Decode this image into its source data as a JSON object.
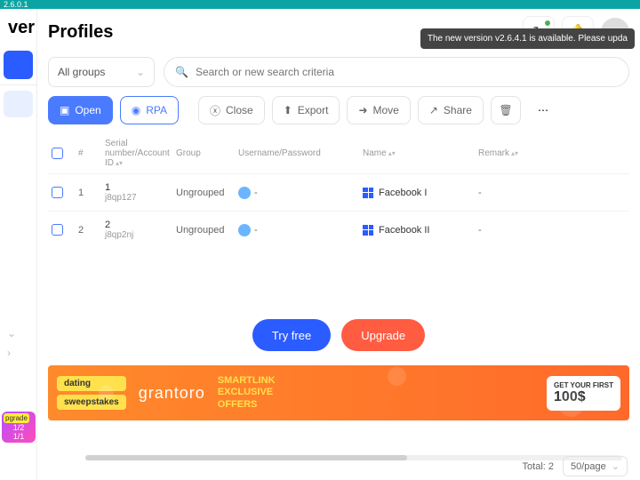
{
  "titlebar": "2.6.0.1",
  "sidebar": {
    "logo": "ver",
    "badge_label": "pgrade",
    "badge_counts": [
      "1/2",
      "1/1"
    ]
  },
  "page": {
    "title": "Profiles"
  },
  "tooltip": "The new version v2.6.4.1 is available. Please upda",
  "filters": {
    "group_label": "All groups",
    "search_placeholder": "Search or new search criteria"
  },
  "toolbar": {
    "open": "Open",
    "rpa": "RPA",
    "close": "Close",
    "export": "Export",
    "move": "Move",
    "share": "Share"
  },
  "columns": {
    "idx": "#",
    "serial": "Serial number/Account ID",
    "group": "Group",
    "userpass": "Username/Password",
    "name": "Name",
    "remark": "Remark"
  },
  "rows": [
    {
      "idx": "1",
      "serial_n": "1",
      "serial_id": "j8qp127",
      "group": "Ungrouped",
      "userpass": "-",
      "name": "Facebook I",
      "remark": "-"
    },
    {
      "idx": "2",
      "serial_n": "2",
      "serial_id": "j8qp2nj",
      "group": "Ungrouped",
      "userpass": "-",
      "name": "Facebook II",
      "remark": "-"
    }
  ],
  "cta": {
    "try": "Try free",
    "upgrade": "Upgrade"
  },
  "ad": {
    "tag1": "dating",
    "tag2": "sweepstakes",
    "brand": "grantoro",
    "line1": "SMARTLINK",
    "line2": "EXCLUSIVE",
    "line3": "OFFERS",
    "bonus_pre": "GET YOUR FIRST",
    "bonus_amt": "100$"
  },
  "footer": {
    "total_label": "Total:",
    "total_value": "2",
    "pager": "50/page"
  }
}
